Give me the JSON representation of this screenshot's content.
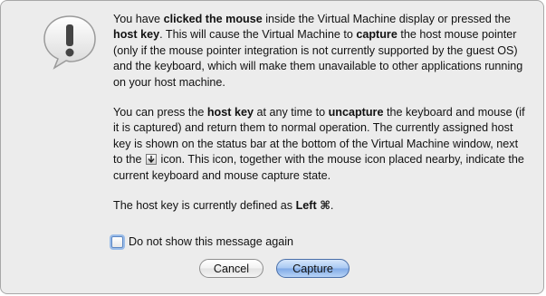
{
  "message": {
    "p1": [
      {
        "t": "You have ",
        "b": false
      },
      {
        "t": "clicked the mouse",
        "b": true
      },
      {
        "t": " inside the Virtual Machine display or pressed the ",
        "b": false
      },
      {
        "t": "host key",
        "b": true
      },
      {
        "t": ". This will cause the Virtual Machine to ",
        "b": false
      },
      {
        "t": "capture",
        "b": true
      },
      {
        "t": " the host mouse pointer (only if the mouse pointer integration is not currently supported by the guest OS) and the keyboard, which will make them unavailable to other applications running on your host machine.",
        "b": false
      }
    ],
    "p2_before_icon": [
      {
        "t": "You can press the ",
        "b": false
      },
      {
        "t": "host key",
        "b": true
      },
      {
        "t": " at any time to ",
        "b": false
      },
      {
        "t": "uncapture",
        "b": true
      },
      {
        "t": " the keyboard and mouse (if it is captured) and return them to normal operation. The currently assigned host key is shown on the status bar at the bottom of the Virtual Machine window, next to the ",
        "b": false
      }
    ],
    "p2_after_icon": [
      {
        "t": " icon. This icon, together with the mouse icon placed nearby, indicate the current keyboard and mouse capture state.",
        "b": false
      }
    ],
    "p3": [
      {
        "t": "The host key is currently defined as ",
        "b": false
      },
      {
        "t": "Left ⌘",
        "b": true
      },
      {
        "t": ".",
        "b": false
      }
    ]
  },
  "checkbox": {
    "label": "Do not show this message again",
    "checked": false
  },
  "buttons": {
    "cancel_label": "Cancel",
    "capture_label": "Capture"
  },
  "icons": {
    "alert": "alert-icon",
    "host_key": "host-key-icon"
  },
  "colors": {
    "dialog_bg": "#ececec",
    "default_button": "#a8c8f2",
    "focus_ring": "#9bbce8"
  }
}
